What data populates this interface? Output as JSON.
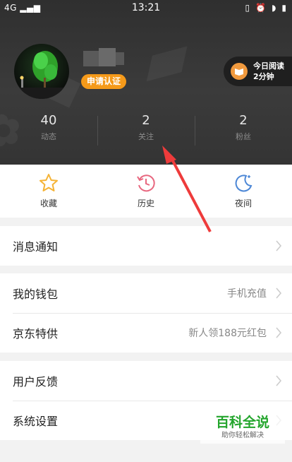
{
  "status_bar": {
    "signal": "4G",
    "time": "13:21"
  },
  "profile": {
    "cert_button": "申请认证"
  },
  "reading": {
    "line1": "今日阅读",
    "line2": "2分钟"
  },
  "stats": [
    {
      "value": "40",
      "label": "动态"
    },
    {
      "value": "2",
      "label": "关注"
    },
    {
      "value": "2",
      "label": "粉丝"
    }
  ],
  "quick_actions": [
    {
      "label": "收藏",
      "icon": "star-icon"
    },
    {
      "label": "历史",
      "icon": "history-icon"
    },
    {
      "label": "夜间",
      "icon": "moon-icon"
    }
  ],
  "menu": {
    "notifications": "消息通知",
    "wallet": {
      "label": "我的钱包",
      "value": "手机充值"
    },
    "jd": {
      "label": "京东特供",
      "value": "新人领188元红包"
    },
    "feedback": "用户反馈",
    "settings": "系统设置"
  },
  "watermark": {
    "title": "百科全说",
    "subtitle": "助你轻松解决"
  },
  "colors": {
    "accent": "#f59a1a",
    "arrow": "#ee3b3b",
    "header": "#353535"
  }
}
